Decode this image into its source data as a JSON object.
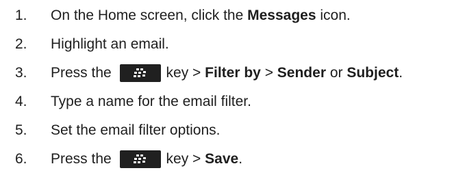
{
  "steps": [
    {
      "number": "1.",
      "parts": [
        "On the Home screen, click the ",
        "Messages",
        " icon."
      ]
    },
    {
      "number": "2.",
      "text": "Highlight an email."
    },
    {
      "number": "3.",
      "parts": [
        "Press the ",
        "key > ",
        "Filter by",
        " > ",
        "Sender",
        " or ",
        "Subject",
        "."
      ],
      "icon": "blackberry-menu-key-icon"
    },
    {
      "number": "4.",
      "text": "Type a name for the email filter."
    },
    {
      "number": "5.",
      "text": "Set the email filter options."
    },
    {
      "number": "6.",
      "parts": [
        "Press the ",
        "key > ",
        "Save",
        "."
      ],
      "icon": "blackberry-menu-key-icon"
    }
  ],
  "colors": {
    "text": "#1f1f1f",
    "key_background": "#202020",
    "key_glyph": "#ffffff"
  }
}
